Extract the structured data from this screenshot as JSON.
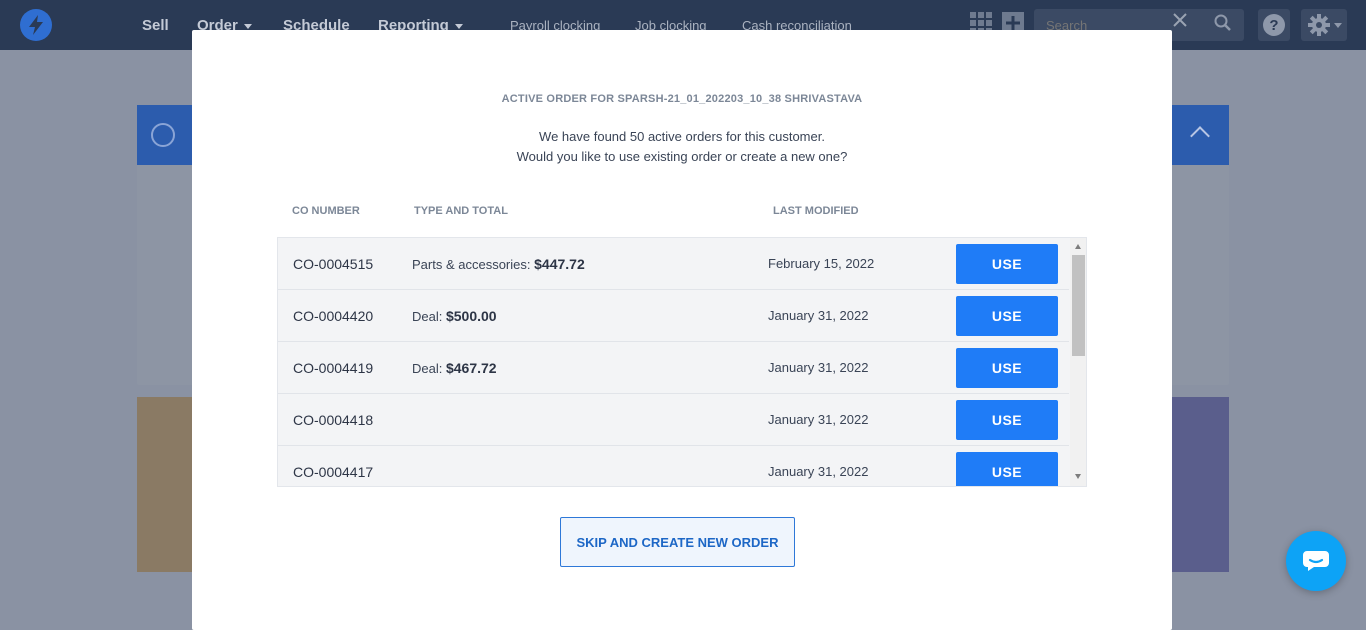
{
  "nav": {
    "items": [
      {
        "label": "Sell",
        "dropdown": false
      },
      {
        "label": "Order",
        "dropdown": true
      },
      {
        "label": "Schedule",
        "dropdown": false
      },
      {
        "label": "Reporting",
        "dropdown": true
      }
    ],
    "links": [
      "Payroll clocking",
      "Job clocking",
      "Cash reconciliation"
    ],
    "search_placeholder": "Search"
  },
  "modal": {
    "title": "ACTIVE ORDER FOR SPARSH-21_01_202203_10_38 SHRIVASTAVA",
    "line1": "We have found 50 active orders for this customer.",
    "line2": "Would you like to use existing order or create a new one?",
    "columns": {
      "co_number": "CO NUMBER",
      "type_total": "TYPE AND TOTAL",
      "last_modified": "LAST MODIFIED"
    },
    "rows": [
      {
        "co": "CO-0004515",
        "type": "Parts & accessories:",
        "total": "$447.72",
        "date": "February 15, 2022",
        "action": "USE"
      },
      {
        "co": "CO-0004420",
        "type": "Deal:",
        "total": "$500.00",
        "date": "January 31, 2022",
        "action": "USE"
      },
      {
        "co": "CO-0004419",
        "type": "Deal:",
        "total": "$467.72",
        "date": "January 31, 2022",
        "action": "USE"
      },
      {
        "co": "CO-0004418",
        "type": "",
        "total": "",
        "date": "January 31, 2022",
        "action": "USE"
      },
      {
        "co": "CO-0004417",
        "type": "",
        "total": "",
        "date": "January 31, 2022",
        "action": "USE"
      }
    ],
    "skip_label": "SKIP AND CREATE NEW ORDER"
  },
  "colors": {
    "accent": "#1f7cf7",
    "nav_bg": "#2a3a55",
    "modal_bg": "#ffffff",
    "row_bg": "#f3f4f6",
    "chat": "#0da3f6"
  }
}
